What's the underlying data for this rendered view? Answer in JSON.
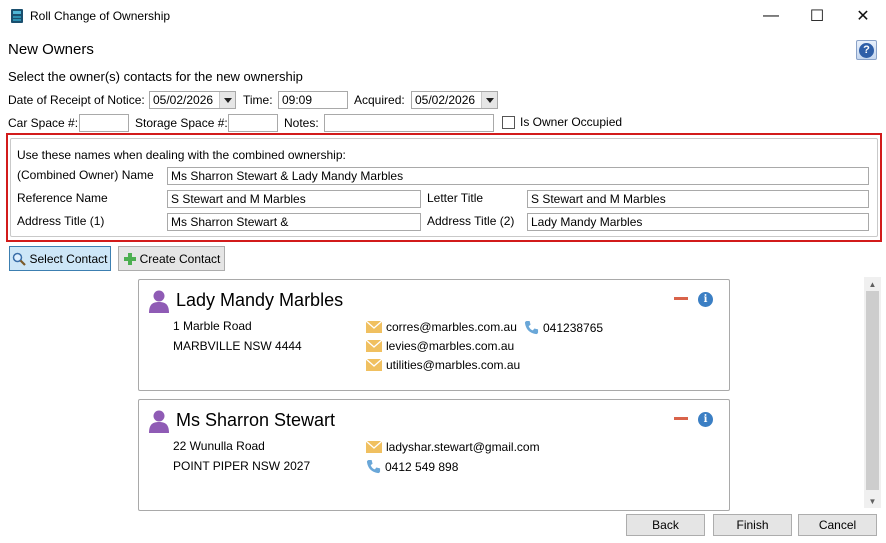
{
  "window": {
    "title": "Roll Change of Ownership",
    "minimize": "—",
    "maximize": "☐",
    "close": "✕"
  },
  "header": {
    "heading": "New Owners",
    "help": "?",
    "subtitle": "Select the owner(s) contacts for the new ownership"
  },
  "row1": {
    "receipt_label": "Date of Receipt of Notice:",
    "receipt_value": "05/02/2026",
    "time_label": "Time:",
    "time_value": "09:09",
    "acquired_label": "Acquired:",
    "acquired_value": "05/02/2026"
  },
  "row2": {
    "car_label": "Car Space #:",
    "car_value": "",
    "storage_label": "Storage Space #:",
    "storage_value": "",
    "notes_label": "Notes:",
    "notes_value": "",
    "occupied_label": "Is Owner Occupied"
  },
  "names": {
    "intro": "Use these names when dealing with the combined ownership:",
    "combined_label": "(Combined Owner) Name",
    "combined_value": "Ms Sharron Stewart & Lady Mandy Marbles",
    "reference_label": "Reference Name",
    "reference_value": "S Stewart and M Marbles",
    "letter_label": "Letter Title",
    "letter_value": "S Stewart and M Marbles",
    "addr1_label": "Address Title (1)",
    "addr1_value": "Ms Sharron Stewart &",
    "addr2_label": "Address Title (2)",
    "addr2_value": "Lady Mandy Marbles"
  },
  "actions": {
    "select_contact": "Select Contact",
    "create_contact": "Create Contact"
  },
  "contacts": [
    {
      "name": "Lady Mandy Marbles",
      "address1": "1 Marble Road",
      "address2": "MARBVILLE NSW 4444",
      "email1": "corres@marbles.com.au",
      "email2": "levies@marbles.com.au",
      "email3": "utilities@marbles.com.au",
      "phone": "041238765"
    },
    {
      "name": "Ms Sharron Stewart",
      "address1": "22 Wunulla Road",
      "address2": "POINT PIPER  NSW  2027",
      "email1": "ladyshar.stewart@gmail.com",
      "phone": "0412 549 898"
    }
  ],
  "footer": {
    "back": "Back",
    "finish": "Finish",
    "cancel": "Cancel"
  },
  "colors": {
    "accent_red": "#d21b1b",
    "person_purple": "#8f5bb5",
    "mail_yellow": "#f0c060",
    "phone_blue": "#6aa7d8",
    "minus_red": "#d9634a",
    "info_blue": "#3b7fc4"
  }
}
